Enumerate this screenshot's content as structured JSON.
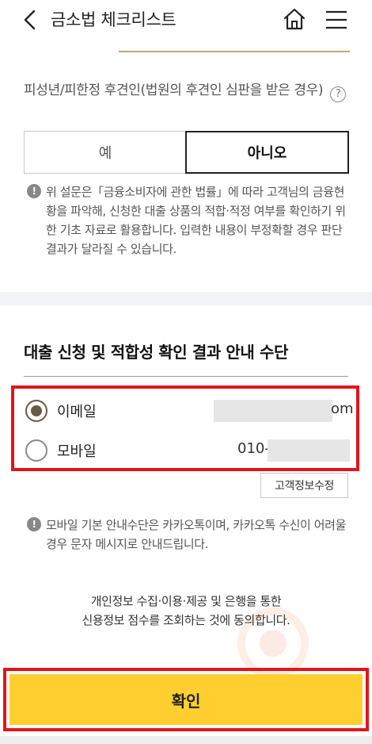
{
  "header": {
    "title": "금소법 체크리스트",
    "back_icon": "back-arrow-icon",
    "home_icon": "home-icon",
    "menu_icon": "hamburger-menu-icon"
  },
  "question": {
    "text": "피성년/피한정 후견인(법원의 후견인 심판을 받은 경우)",
    "help_icon": "?"
  },
  "answer": {
    "yes_label": "예",
    "no_label": "아니오",
    "selected": "아니오"
  },
  "notice1": {
    "icon": "!",
    "text": "위 설문은「금융소비자에 관한 법률」에 따라 고객님의 금융현황을 파악해, 신청한 대출 상품의 적합·적정 여부를 확인하기 위한 기초 자료로 활용합니다. 입력한 내용이 부정확할 경우 판단 결과가 달라질 수 있습니다."
  },
  "section": {
    "title": "대출 신청 및 적합성 확인 결과 안내 수단"
  },
  "contact": {
    "email_label": "이메일",
    "email_value_visible": "om",
    "mobile_label": "모바일",
    "mobile_value_visible": "010-",
    "selected": "이메일"
  },
  "edit_button": "고객정보수정",
  "notice2": {
    "icon": "!",
    "text": "모바일 기본 안내수단은 카카오톡이며, 카카오톡 수신이 어려울 경우 문자 메시지로 안내드립니다."
  },
  "consent": {
    "line1": "개인정보 수집·이용·제공 및 은행을 통한",
    "line2": "신용정보 점수를 조회하는 것에 동의합니다."
  },
  "confirm_button": "확인",
  "colors": {
    "accent_gold": "#bfa77b",
    "confirm_yellow": "#ffcf2f",
    "highlight_red": "#e3141b",
    "radio_brown": "#6b5a48"
  }
}
